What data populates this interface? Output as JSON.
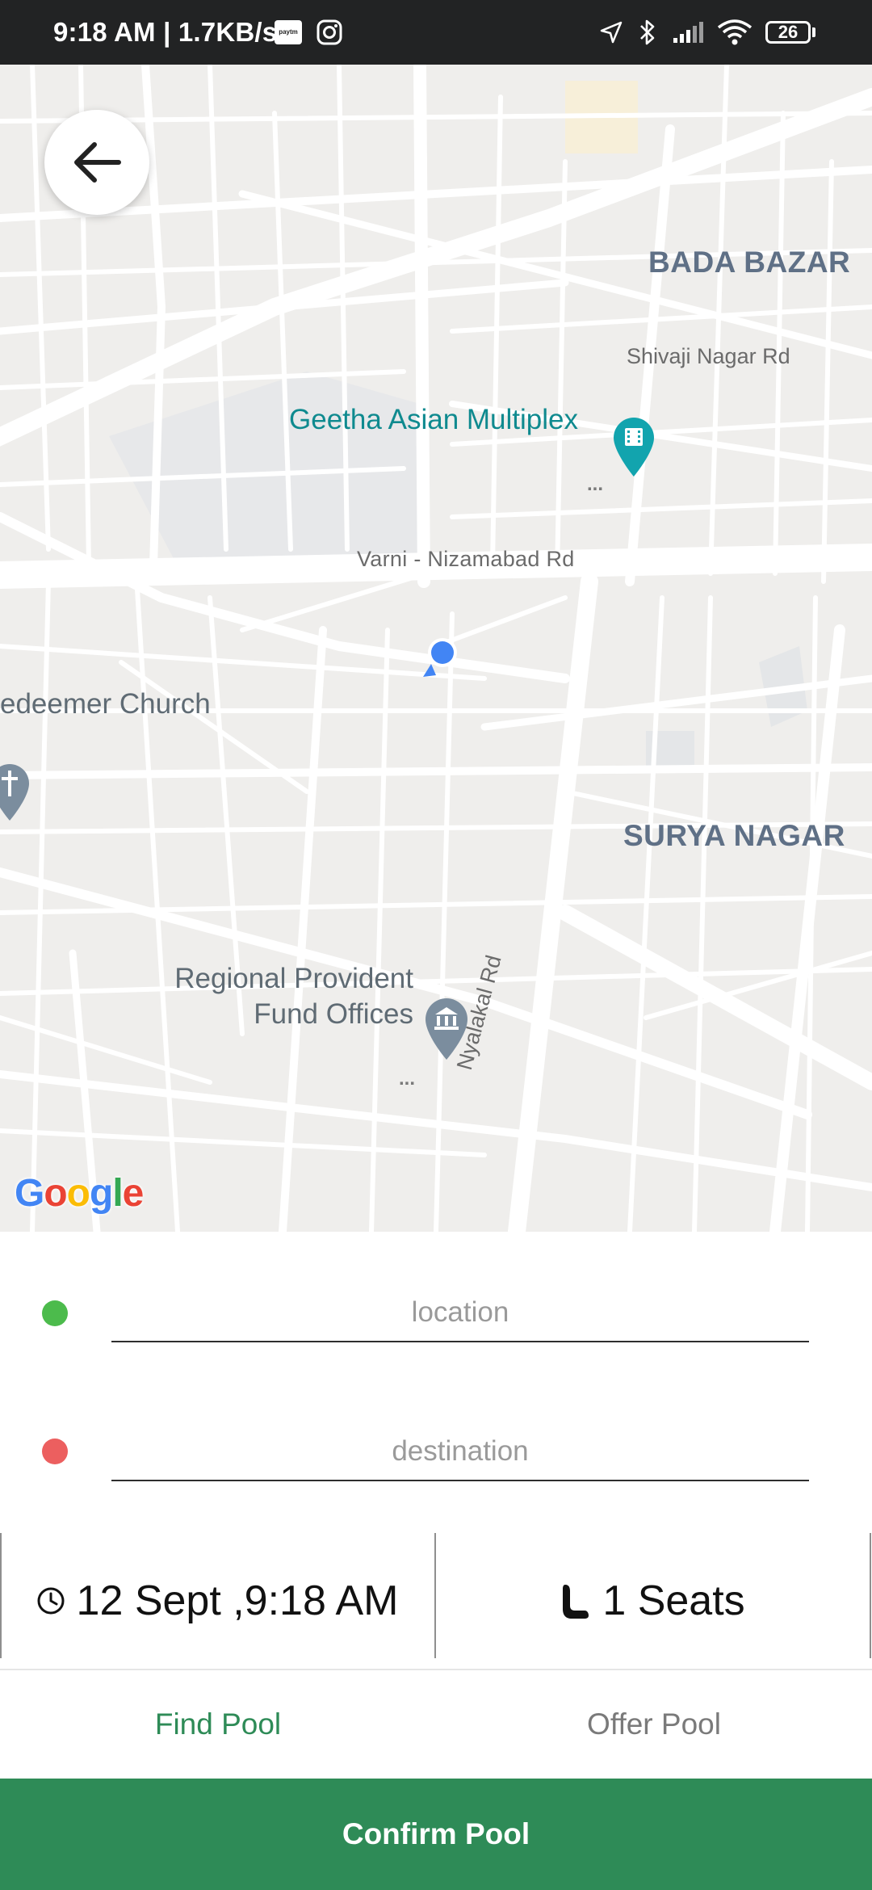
{
  "status_bar": {
    "time": "9:18 AM | 1.7KB/s",
    "paytm_label": "paytm",
    "battery": "26",
    "icons": [
      "paytm-icon",
      "instagram-icon",
      "location-arrow-icon",
      "bluetooth-icon",
      "signal-icon",
      "wifi-icon",
      "battery-icon"
    ]
  },
  "map": {
    "labels": {
      "bada_bazar": "BADA BAZAR",
      "shivaji_road": "Shivaji Nagar Rd",
      "geetha": "Geetha Asian Multiplex",
      "geetha_more": "...",
      "varni_road": "Varni - Nizamabad Rd",
      "church": "edeemer Church",
      "surya_nagar": "SURYA NAGAR",
      "provident_line1": "Regional Provident",
      "provident_line2": "Fund Offices",
      "provident_more": "...",
      "nyalakal_road": "Nyalakal Rd"
    },
    "attribution": "Google",
    "colors": {
      "background": "#efeeec",
      "road": "#ffffff",
      "teal_poi": "#0f8a8f",
      "my_location": "#4285f4"
    }
  },
  "form": {
    "location_placeholder": "location",
    "destination_placeholder": "destination",
    "location_dot_color": "#4cbb4c",
    "destination_dot_color": "#ec5f5f",
    "date_time": "12 Sept ,9:18 AM",
    "seats": "1 Seats"
  },
  "tabs": {
    "find_pool": "Find Pool",
    "offer_pool": "Offer Pool",
    "active": "Find Pool",
    "active_color": "#2e8b57",
    "inactive_color": "#7a7a7a"
  },
  "confirm_button": {
    "label": "Confirm Pool",
    "color": "#2e8b57"
  }
}
